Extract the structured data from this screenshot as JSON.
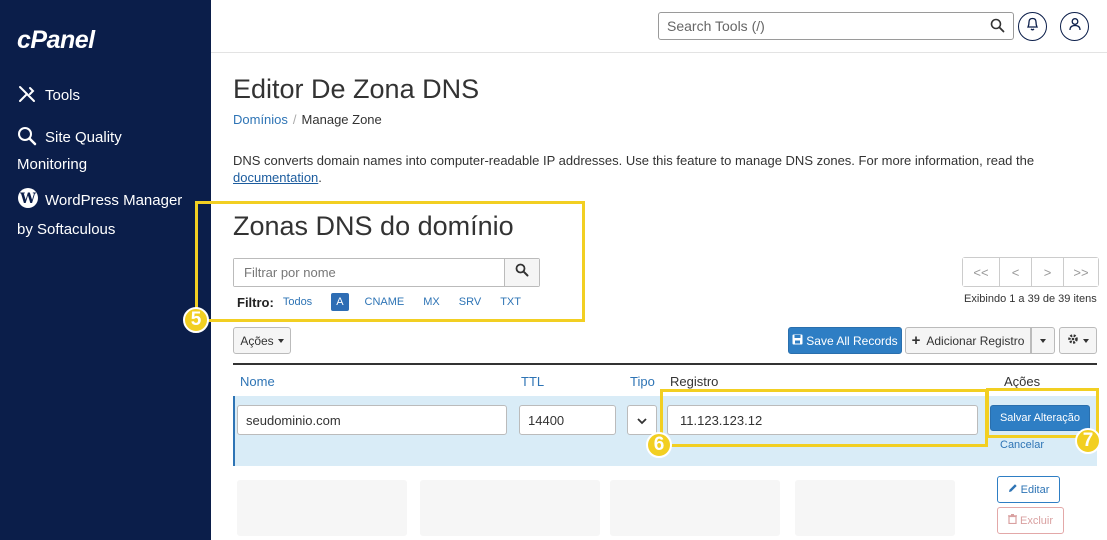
{
  "sidebar": {
    "logo": "cPanel",
    "items": [
      {
        "label": "Tools"
      },
      {
        "label": "Site Quality",
        "label2": "Monitoring"
      },
      {
        "label": "WordPress Manager",
        "label2": "by Softaculous"
      }
    ]
  },
  "header": {
    "search_placeholder": "Search Tools (/)"
  },
  "page": {
    "title": "Editor De Zona DNS",
    "breadcrumb": {
      "link": "Domínios",
      "current": "Manage Zone"
    },
    "description": "DNS converts domain names into computer-readable IP addresses. Use this feature to manage DNS zones. For more information, read the",
    "description_link": "documentation",
    "description_end": "."
  },
  "zones": {
    "title": "Zonas DNS do domínio",
    "filter_placeholder": "Filtrar por nome",
    "filtro_label": "Filtro:",
    "filters": [
      "Todos",
      "A",
      "CNAME",
      "MX",
      "SRV",
      "TXT"
    ],
    "active_filter": "A",
    "pager": [
      "<<",
      "<",
      ">",
      ">>"
    ],
    "showing": "Exibindo 1 a 39 de 39 itens"
  },
  "toolbar": {
    "acoes": "Ações",
    "save_all": "Save All Records",
    "add_record": "Adicionar Registro"
  },
  "table": {
    "headers": {
      "nome": "Nome",
      "ttl": "TTL",
      "tipo": "Tipo",
      "registro": "Registro",
      "acoes": "Ações"
    },
    "edit_row": {
      "nome": "seudominio.com",
      "ttl": "14400",
      "registro": "11.123.123.12",
      "save": "Salvar Alteração",
      "cancel": "Cancelar"
    },
    "row_actions": {
      "edit": "Editar",
      "delete": "Excluir"
    }
  },
  "callouts": [
    "5",
    "6",
    "7"
  ],
  "colors": {
    "sidebar": "#0b1e4a",
    "accent": "#2e7ec4",
    "highlight": "#f2cf22",
    "danger": "#e0a0a0"
  }
}
